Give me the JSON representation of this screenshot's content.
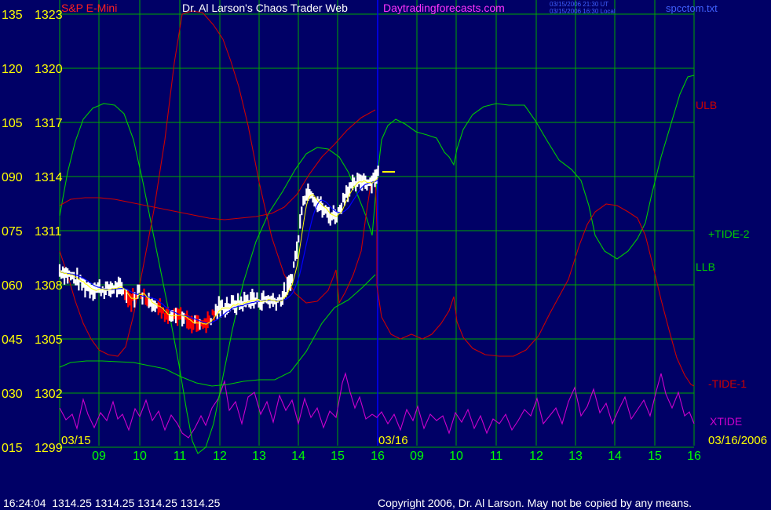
{
  "header": {
    "symbol": "S&P E-Mini",
    "author": "Dr. Al Larson's Chaos Trader Web",
    "website": "Daytradingforecasts.com",
    "stamp_line1": "03/15/2006 21:30 UT",
    "stamp_line2": "03/15/2006 16:30 Local",
    "filename": "spcctom.txt"
  },
  "footer": {
    "quote": "16:24:04  1314.25 1314.25 1314.25 1314.25",
    "copyright": "Copyright 2006, Dr. Al Larson. May not be copied by any means."
  },
  "colors": {
    "background": "#000066",
    "grid": "#00a800",
    "left_labels": "#ffff00",
    "time_labels": "#00ff00",
    "price_bars": "#ffffff",
    "price_bars_down": "#ff0000",
    "fast_avg": "#ffff00",
    "slow_avg": "#0000ff",
    "tide": "#00cc00",
    "bands": "#cc0000",
    "xtide": "#cc00cc",
    "divider": "#0000ff"
  },
  "chart_data": {
    "type": "line",
    "title": "S&P E-Mini",
    "y_left_outer_ticks": [
      "135",
      "120",
      "105",
      "090",
      "075",
      "060",
      "045",
      "030",
      "015"
    ],
    "y_left_price_ticks": [
      "1323",
      "1320",
      "1317",
      "1314",
      "1311",
      "1308",
      "1305",
      "1302",
      "1299"
    ],
    "price_range": [
      1299,
      1323
    ],
    "x_ticks": [
      "09",
      "10",
      "11",
      "12",
      "13",
      "14",
      "15",
      "16",
      "09",
      "10",
      "11",
      "12",
      "13",
      "14",
      "15",
      "16"
    ],
    "date_labels": [
      "03/15",
      "03/16",
      "03/16/2006"
    ],
    "current_price": 1314.25,
    "right_labels": [
      "ULB",
      "+TIDE-2",
      "LLB",
      "-TIDE-1",
      "XTIDE"
    ],
    "series": [
      {
        "name": "ULB",
        "role": "upper band"
      },
      {
        "name": "+TIDE-2",
        "role": "tide"
      },
      {
        "name": "LLB",
        "role": "lower band"
      },
      {
        "name": "-TIDE-1",
        "role": "tide"
      },
      {
        "name": "XTIDE",
        "role": "oscillator"
      }
    ],
    "price_path": [
      [
        8.0,
        1308.8
      ],
      [
        8.2,
        1308.6
      ],
      [
        8.4,
        1308.3
      ],
      [
        8.6,
        1308.0
      ],
      [
        8.8,
        1307.8
      ],
      [
        9.0,
        1307.8
      ],
      [
        9.2,
        1307.7
      ],
      [
        9.4,
        1307.9
      ],
      [
        9.6,
        1307.6
      ],
      [
        9.8,
        1307.2
      ],
      [
        10.0,
        1307.6
      ],
      [
        10.2,
        1307.3
      ],
      [
        10.4,
        1307.0
      ],
      [
        10.6,
        1306.4
      ],
      [
        10.8,
        1306.2
      ],
      [
        11.0,
        1306.2
      ],
      [
        11.2,
        1306.1
      ],
      [
        11.4,
        1306.0
      ],
      [
        11.6,
        1305.8
      ],
      [
        11.8,
        1306.2
      ],
      [
        12.0,
        1306.7
      ],
      [
        12.2,
        1306.8
      ],
      [
        12.4,
        1306.9
      ],
      [
        12.6,
        1307.0
      ],
      [
        12.8,
        1307.2
      ],
      [
        13.0,
        1307.1
      ],
      [
        13.2,
        1307.2
      ],
      [
        13.4,
        1307.1
      ],
      [
        13.6,
        1307.3
      ],
      [
        13.8,
        1308.1
      ],
      [
        14.0,
        1310.5
      ],
      [
        14.1,
        1312.8
      ],
      [
        14.2,
        1313.0
      ],
      [
        14.3,
        1313.3
      ],
      [
        14.4,
        1312.8
      ],
      [
        14.6,
        1312.2
      ],
      [
        14.8,
        1311.8
      ],
      [
        15.0,
        1312.0
      ],
      [
        15.2,
        1313.2
      ],
      [
        15.4,
        1313.5
      ],
      [
        15.6,
        1313.8
      ],
      [
        15.8,
        1313.7
      ],
      [
        16.0,
        1314.25
      ]
    ]
  }
}
